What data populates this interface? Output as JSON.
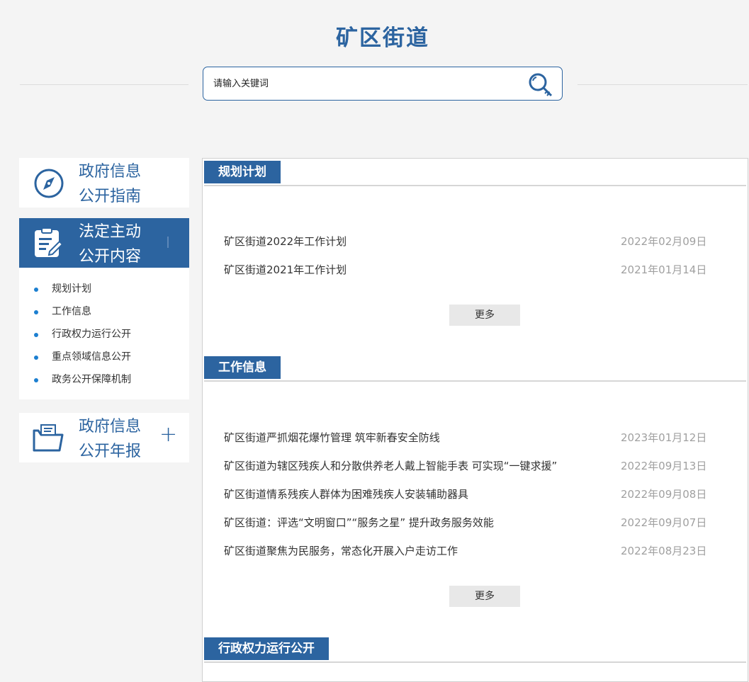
{
  "site": {
    "title": "矿区街道"
  },
  "search": {
    "placeholder": "请输入关键词",
    "icon": "search-key-icon"
  },
  "colors": {
    "brand": "#2c64a0",
    "bullet": "#1c7fd0",
    "date": "#a0a0a0",
    "page_bg": "#f4f4f4"
  },
  "sidebar": {
    "guide": {
      "line1": "政府信息",
      "line2": "公开指南",
      "icon": "compass-icon"
    },
    "active": {
      "line1": "法定主动",
      "line2": "公开内容",
      "icon": "clipboard-edit-icon"
    },
    "subitems": [
      "规划计划",
      "工作信息",
      "行政权力运行公开",
      "重点领域信息公开",
      "政务公开保障机制"
    ],
    "annual": {
      "line1": "政府信息",
      "line2": "公开年报",
      "expand": "+",
      "icon": "folder-documents-icon"
    }
  },
  "sections": [
    {
      "title": "规划计划",
      "items": [
        {
          "title": "矿区街道2022年工作计划",
          "date": "2022年02月09日"
        },
        {
          "title": "矿区街道2021年工作计划",
          "date": "2021年01月14日"
        }
      ],
      "more": "更多"
    },
    {
      "title": "工作信息",
      "items": [
        {
          "title": "矿区街道严抓烟花爆竹管理 筑牢新春安全防线",
          "date": "2023年01月12日"
        },
        {
          "title": "矿区街道为辖区残疾人和分散供养老人戴上智能手表 可实现“一键求援”",
          "date": "2022年09月13日"
        },
        {
          "title": "矿区街道情系残疾人群体为困难残疾人安装辅助器具",
          "date": "2022年09月08日"
        },
        {
          "title": "矿区街道：评选“文明窗口”“服务之星” 提升政务服务效能",
          "date": "2022年09月07日"
        },
        {
          "title": "矿区街道聚焦为民服务，常态化开展入户走访工作",
          "date": "2022年08月23日"
        }
      ],
      "more": "更多"
    },
    {
      "title": "行政权力运行公开"
    }
  ]
}
